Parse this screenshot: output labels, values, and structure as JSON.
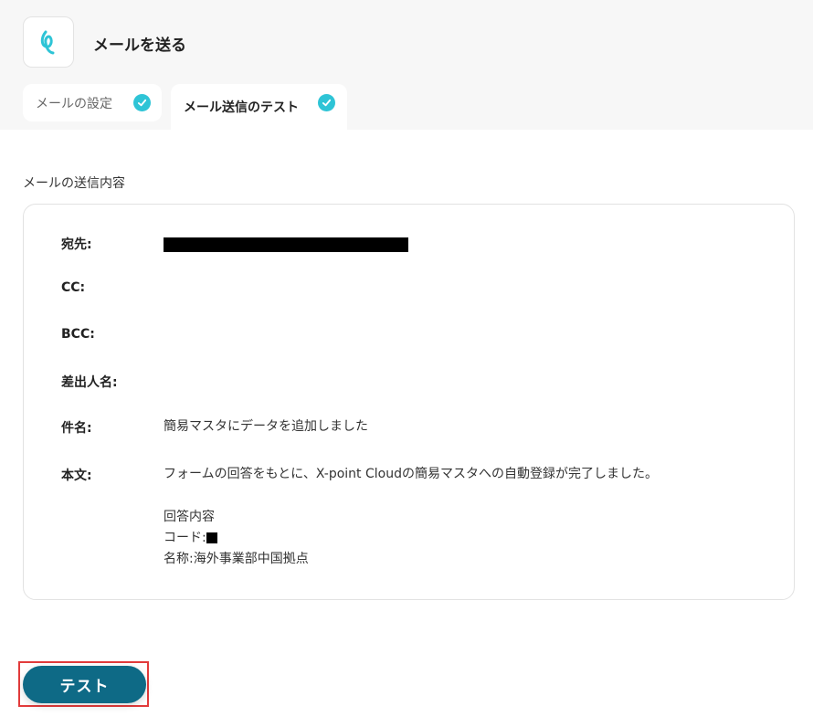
{
  "header": {
    "app_icon": "yoom-logo-icon",
    "title": "メールを送る"
  },
  "tabs": [
    {
      "label": "メールの設定",
      "status_icon": "check-circle-icon",
      "active": false
    },
    {
      "label": "メール送信のテスト",
      "status_icon": "check-circle-icon",
      "active": true
    }
  ],
  "section_label": "メールの送信内容",
  "email": {
    "to_label": "宛先:",
    "cc_label": "CC:",
    "bcc_label": "BCC:",
    "sender_label": "差出人名:",
    "subject_label": "件名:",
    "subject_value": "簡易マスタにデータを追加しました",
    "body_label": "本文:",
    "body_line1": "フォームの回答をもとに、X-point Cloudの簡易マスタへの自動登録が完了しました。",
    "body_line2": "回答内容",
    "body_line3_prefix": "コード:",
    "body_line4": "名称:海外事業部中国拠点"
  },
  "actions": {
    "test_label": "テスト"
  },
  "colors": {
    "accent_check": "#2ec4d6",
    "test_button": "#0e6a86",
    "focus_outline": "#e23b3b"
  }
}
